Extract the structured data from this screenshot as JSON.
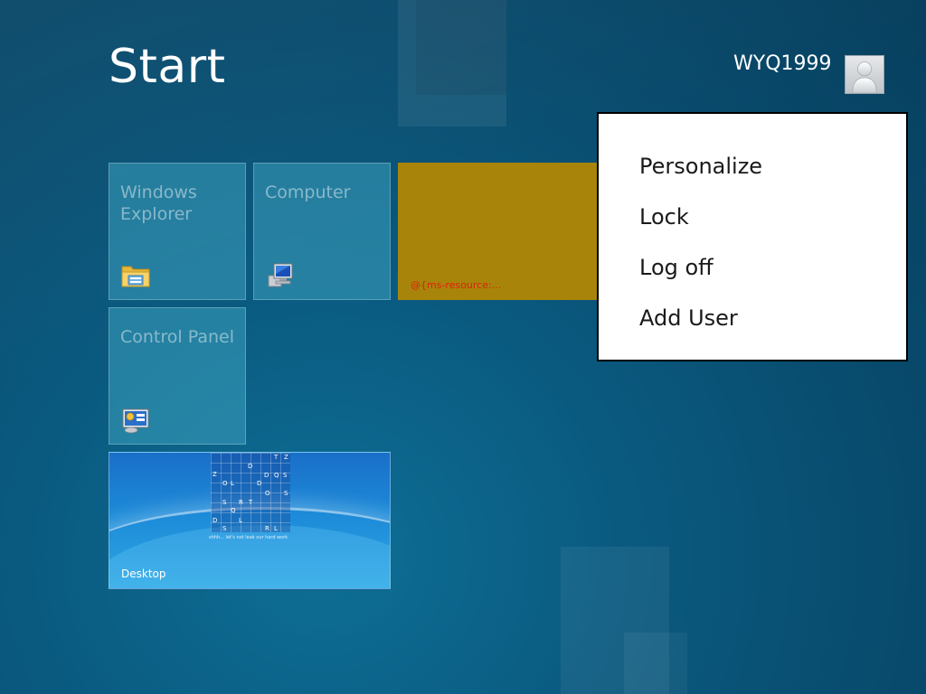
{
  "header": {
    "title": "Start",
    "user_name": "WYQ1999"
  },
  "tiles": {
    "explorer": {
      "label": "Windows Explorer",
      "icon": "folder-icon"
    },
    "computer": {
      "label": "Computer",
      "icon": "computer-icon"
    },
    "control_panel": {
      "label": "Control Panel",
      "icon": "control-panel-icon"
    },
    "resource": {
      "label": "@{ms-resource:...",
      "color": "#a8850a"
    },
    "desktop": {
      "label": "Desktop",
      "wallpaper_caption": "shhh... let's not leak our hard work",
      "grid_letters": [
        "T",
        "Z",
        "Z",
        "D",
        "D",
        "Q",
        "S",
        "O",
        "L",
        "D",
        "O",
        "S",
        "S",
        "R",
        "T",
        "Q",
        "D",
        "L",
        "S",
        "R",
        "L"
      ]
    }
  },
  "context_menu": {
    "items": [
      "Personalize",
      "Lock",
      "Log off",
      "Add User"
    ]
  },
  "colors": {
    "background": "#0a5a80",
    "tile_blue": "#3ca0be",
    "tile_gold": "#a8850a",
    "menu_bg": "#ffffff",
    "resource_text": "#e02010"
  }
}
